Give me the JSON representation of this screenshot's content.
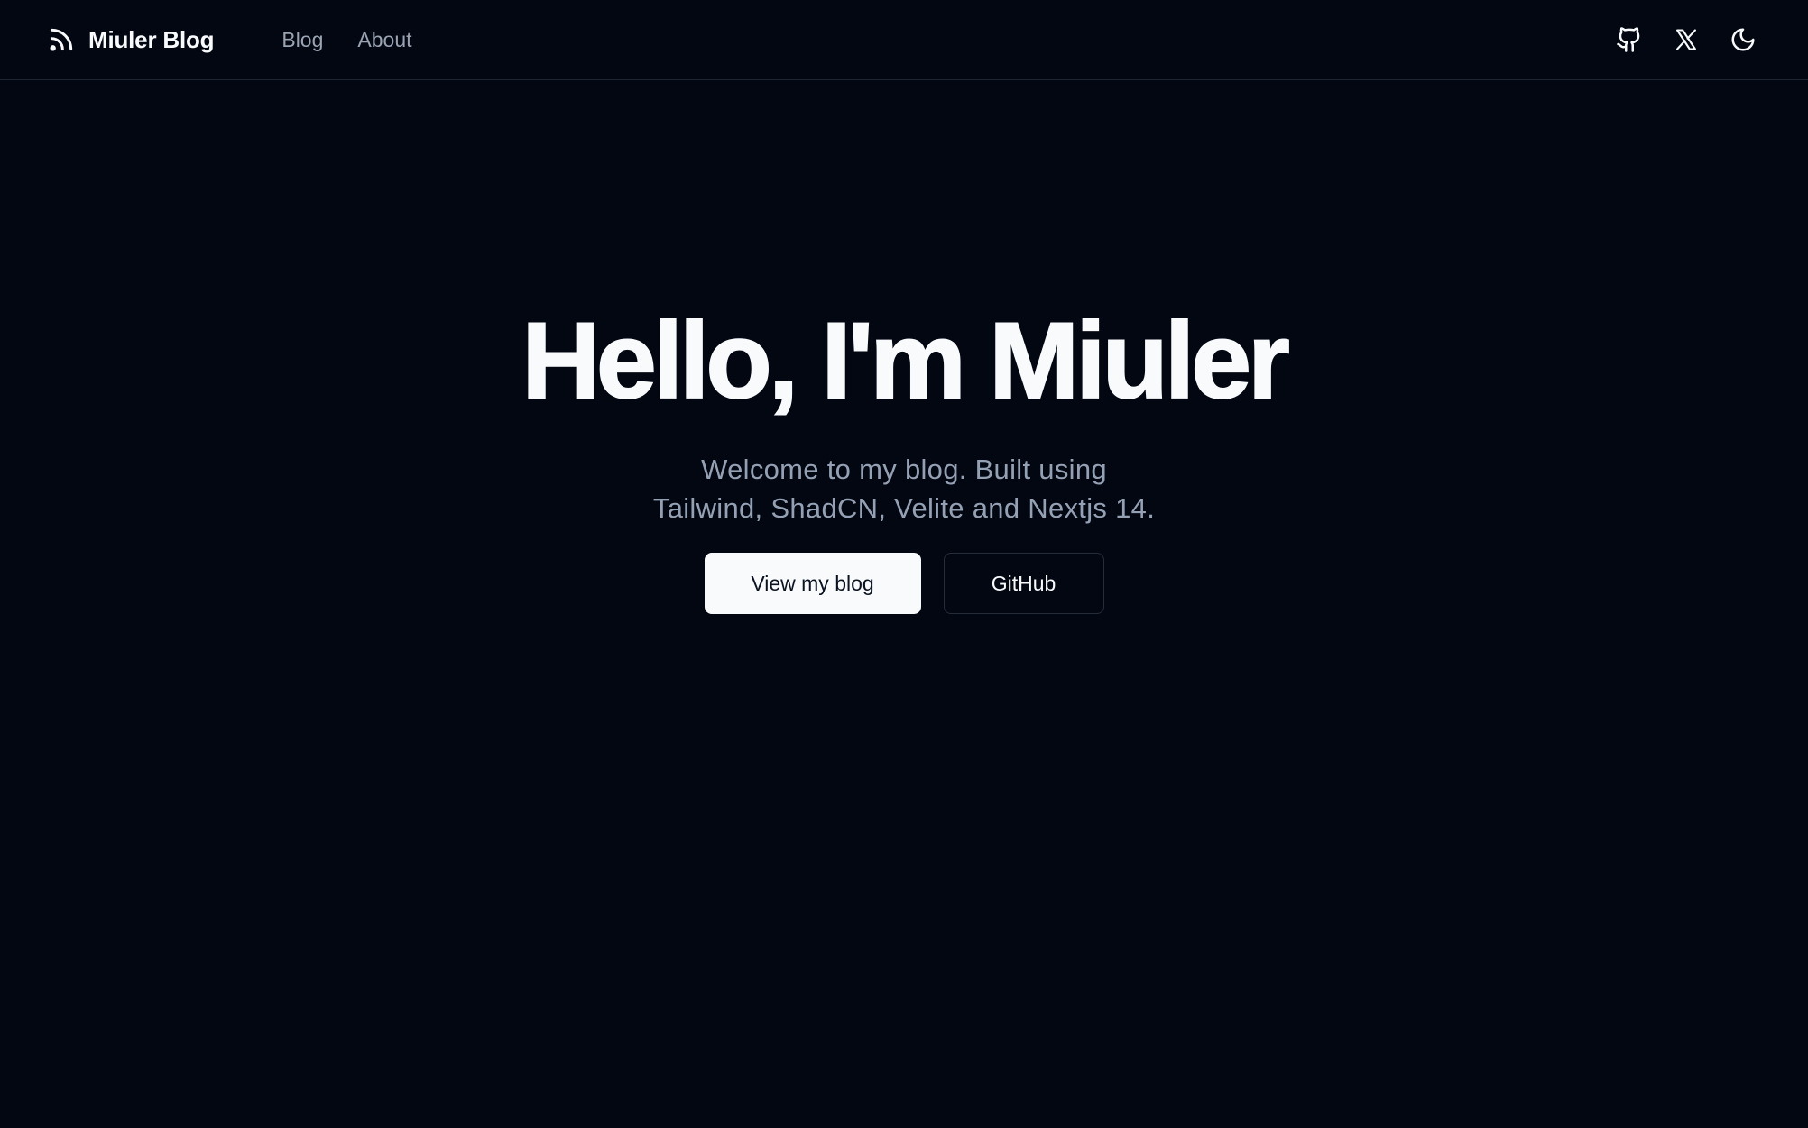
{
  "header": {
    "brand": {
      "icon": "rss-icon",
      "name": "Miuler Blog"
    },
    "nav": [
      {
        "label": "Blog"
      },
      {
        "label": "About"
      }
    ],
    "actions": [
      {
        "icon": "github-icon"
      },
      {
        "icon": "x-twitter-icon"
      },
      {
        "icon": "moon-icon"
      }
    ]
  },
  "hero": {
    "title": "Hello, I'm Miuler",
    "subtitle_line1": "Welcome to my blog. Built using",
    "subtitle_line2": "Tailwind, ShadCN, Velite and Nextjs 14.",
    "primary_button": "View my blog",
    "secondary_button": "GitHub"
  },
  "colors": {
    "background": "#030712",
    "foreground": "#f8fafc",
    "muted": "#94a0b3",
    "border": "#1e2533"
  }
}
